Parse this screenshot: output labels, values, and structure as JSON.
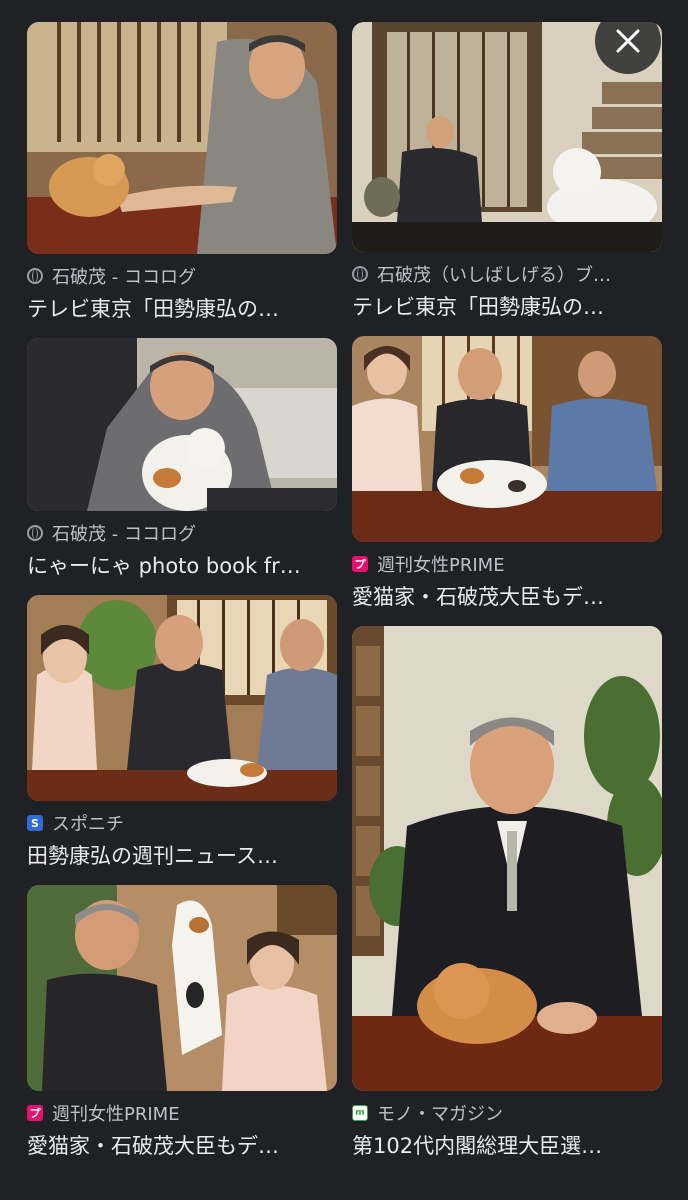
{
  "close": {
    "icon": "close-icon"
  },
  "results": [
    {
      "source": "石破茂 - ココログ",
      "favicon": "globe-icon",
      "title": "テレビ東京「田勢康弘の…"
    },
    {
      "source": "石破茂（いしばしげる）ブ…",
      "favicon": "globe-icon",
      "title": "テレビ東京「田勢康弘の…"
    },
    {
      "source": "石破茂 - ココログ",
      "favicon": "globe-icon",
      "title": "にゃーにゃ photo book fr…"
    },
    {
      "source": "週刊女性PRIME",
      "favicon": "prime-logo-icon",
      "favicon_text": "プ",
      "title": "愛猫家・石破茂大臣もデ…"
    },
    {
      "source": "スポニチ",
      "favicon": "sponichi-logo-icon",
      "favicon_text": "S",
      "title": "田勢康弘の週刊ニュース…"
    },
    {
      "source": "モノ・マガジン",
      "favicon": "monomagazine-logo-icon",
      "favicon_text": "m",
      "title": "第102代内閣総理大臣選…"
    },
    {
      "source": "週刊女性PRIME",
      "favicon": "prime-logo-icon",
      "favicon_text": "プ",
      "title": "愛猫家・石破茂大臣もデ…"
    }
  ]
}
